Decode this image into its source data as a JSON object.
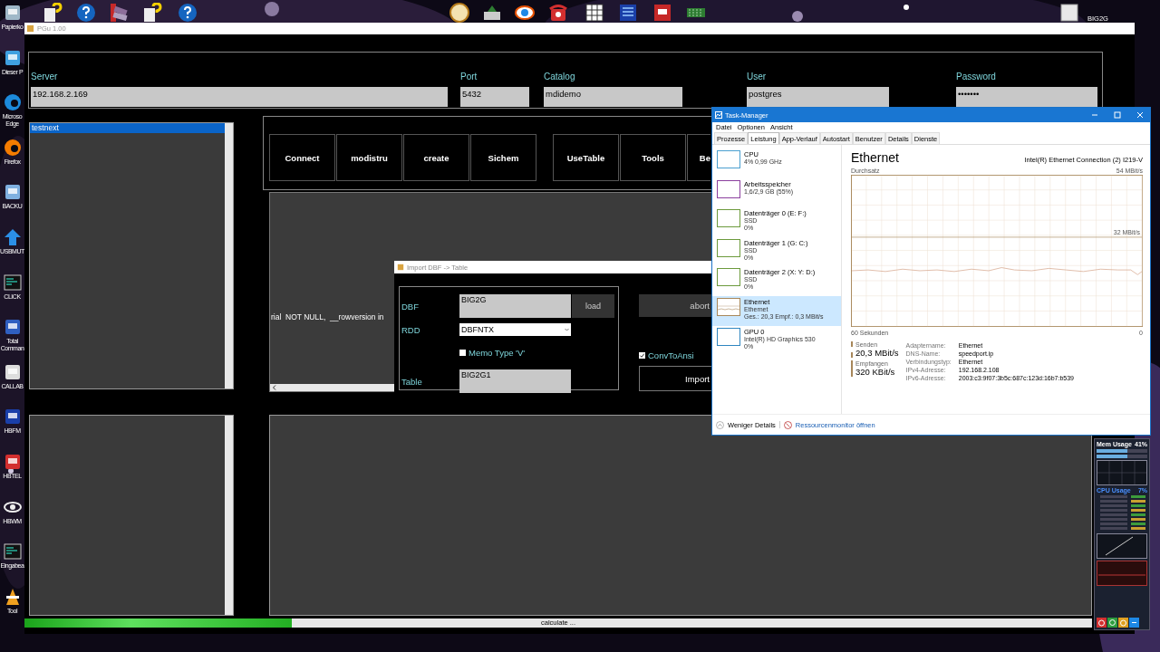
{
  "desktop": {
    "icons": [
      {
        "label": "Papierko"
      },
      {
        "label": "Dieser P"
      },
      {
        "label": "Microso Edge"
      },
      {
        "label": "Firefox"
      },
      {
        "label": "BACKU"
      },
      {
        "label": "USBMUT"
      },
      {
        "label": "CLICK"
      },
      {
        "label": "Total Comman"
      },
      {
        "label": "CALLAB"
      },
      {
        "label": "HBFM"
      },
      {
        "label": "HBTEL"
      },
      {
        "label": "HBWM"
      },
      {
        "label": "Eingabea"
      },
      {
        "label": "Tool"
      }
    ],
    "top_right_icon": {
      "label": "BIG2G"
    }
  },
  "app": {
    "title": "PGu 1.00",
    "fields": [
      {
        "label": "Server",
        "value": "192.168.2.169"
      },
      {
        "label": "Port",
        "value": "5432"
      },
      {
        "label": "Catalog",
        "value": "mdidemo"
      },
      {
        "label": "User",
        "value": "postgres"
      },
      {
        "label": "Password",
        "value": "•••••••"
      }
    ],
    "databases": [
      {
        "label": "testnext",
        "selected": true
      }
    ],
    "button_groups": [
      {
        "buttons": [
          "Connect",
          "modistru",
          "create",
          "Sichem"
        ]
      },
      {
        "buttons": [
          "UseTable",
          "Tools",
          "Be"
        ]
      }
    ],
    "log_text": "rial  NOT NULL,  __rowversion in",
    "progress": {
      "level": 0.25,
      "text": "calculate ..."
    }
  },
  "import_dialog": {
    "title": "Import DBF -> Table",
    "dbf": {
      "label": "DBF",
      "value": "BIG2G"
    },
    "load_button": "load",
    "rdd": {
      "label": "RDD",
      "value": "DBFNTX"
    },
    "memo_type": {
      "label": "Memo Type 'V'",
      "checked": false
    },
    "table": {
      "label": "Table",
      "value": "BIG2G1"
    },
    "abort_button": "abort",
    "conv_to_ansi": {
      "label": "ConvToAnsi",
      "checked": true
    },
    "import_button": "Import"
  },
  "task_manager": {
    "title": "Task-Manager",
    "menu": [
      "Datei",
      "Optionen",
      "Ansicht"
    ],
    "tabs": [
      {
        "label": "Prozesse",
        "selected": false
      },
      {
        "label": "Leistung",
        "selected": true
      },
      {
        "label": "App-Verlauf",
        "selected": false
      },
      {
        "label": "Autostart",
        "selected": false
      },
      {
        "label": "Benutzer",
        "selected": false
      },
      {
        "label": "Details",
        "selected": false
      },
      {
        "label": "Dienste",
        "selected": false
      }
    ],
    "resources": [
      {
        "name": "CPU",
        "lines": [
          "4% 0,99 GHz"
        ],
        "color": "#4a9fd0",
        "selected": false
      },
      {
        "name": "Arbeitsspeicher",
        "lines": [
          "1,6/2,9 GB (55%)"
        ],
        "color": "#8b3f9e",
        "selected": false
      },
      {
        "name": "Datenträger 0 (E: F:)",
        "lines": [
          "SSD",
          "0%"
        ],
        "color": "#6c9a3c",
        "selected": false
      },
      {
        "name": "Datenträger 1 (G: C:)",
        "lines": [
          "SSD",
          "0%"
        ],
        "color": "#6c9a3c",
        "selected": false
      },
      {
        "name": "Datenträger 2 (X: Y: D:)",
        "lines": [
          "SSD",
          "0%"
        ],
        "color": "#6c9a3c",
        "selected": false
      },
      {
        "name": "Ethernet",
        "lines": [
          "Ethernet",
          "Ges.: 20,3 Empf.: 0,3 MBit/s"
        ],
        "color": "#a7875a",
        "selected": true
      },
      {
        "name": "GPU 0",
        "lines": [
          "Intel(R) HD Graphics 530",
          "0%"
        ],
        "color": "#2f86c0",
        "selected": false
      }
    ],
    "detail": {
      "title": "Ethernet",
      "adapter": "Intel(R) Ethernet Connection (2) I219-V",
      "graph_label": "Durchsatz",
      "graph_max": "54 MBit/s",
      "graph_mid": "32 MBit/s",
      "graph_time": "60 Sekunden",
      "graph_end": "0",
      "send_label": "Senden",
      "send_value": "20,3 MBit/s",
      "receive_label": "Empfangen",
      "receive_value": "320 KBit/s",
      "properties": [
        {
          "label": "Adaptername:",
          "value": "Ethernet"
        },
        {
          "label": "DNS-Name:",
          "value": "speedport.ip"
        },
        {
          "label": "Verbindungstyp:",
          "value": "Ethernet"
        },
        {
          "label": "IPv4-Adresse:",
          "value": "192.168.2.108"
        },
        {
          "label": "IPv6-Adresse:",
          "value": "2003:c3:9f07:3b5c:687c:123d:16b7:b539"
        }
      ]
    },
    "footer": [
      "Weniger Details",
      "Ressourcenmonitor öffnen"
    ]
  },
  "gadget": {
    "title": "Mem Usage",
    "value": "41%",
    "cpu_title": "CPU Usage",
    "cpu_value": "7%"
  }
}
